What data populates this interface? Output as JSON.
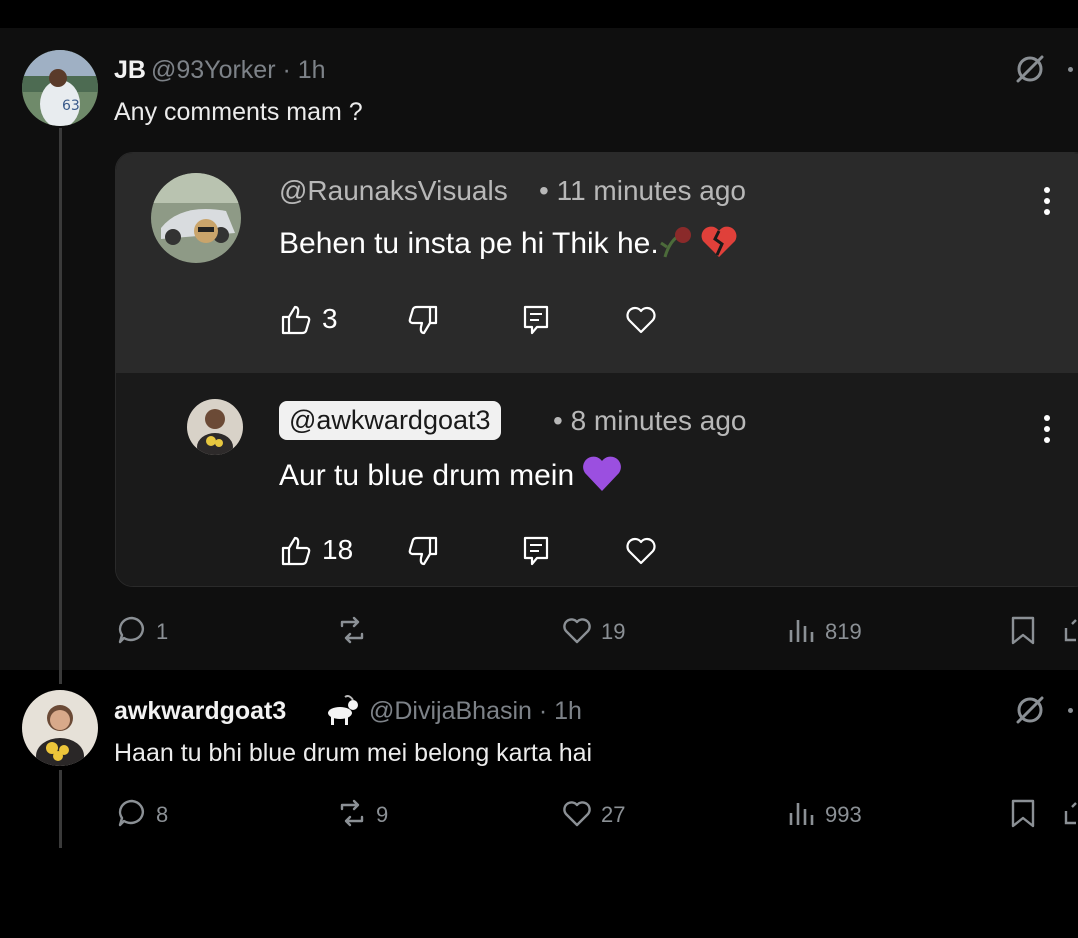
{
  "tweet1": {
    "name": "JB",
    "handle": "@93Yorker · 1h",
    "text": "Any comments mam ?",
    "actions": {
      "replies": "1",
      "retweets": "",
      "likes": "19",
      "views": "819"
    }
  },
  "youtube": {
    "comment": {
      "handle": "@RaunaksVisuals",
      "time": "• 11 minutes ago",
      "text": "Behen tu insta pe hi Thik he.",
      "likes": "3"
    },
    "reply": {
      "handle": "@awkwardgoat3",
      "time": "• 8 minutes ago",
      "text": "Aur tu blue drum mein",
      "likes": "18"
    }
  },
  "tweet2": {
    "name": "awkwardgoat3",
    "handle": "@DivijaBhasin · 1h",
    "text": "Haan tu bhi blue drum mei belong karta hai",
    "actions": {
      "replies": "8",
      "retweets": "9",
      "likes": "27",
      "views": "993"
    }
  },
  "colors": {
    "background": "#000000",
    "card_top": "#2a2a2a",
    "card_bottom": "#1a1a1a",
    "muted": "#7d8288",
    "purple_heart": "#9b4fe0",
    "broken_heart": "#e0403a"
  },
  "icons": [
    "grok-icon",
    "more-icon",
    "thumbs-up-icon",
    "thumbs-down-icon",
    "reply-icon",
    "heart-icon",
    "kebab-menu-icon",
    "retweet-icon",
    "views-icon",
    "bookmark-icon",
    "share-icon",
    "goat-emoji",
    "wilted-rose-emoji",
    "broken-heart-emoji",
    "purple-heart-emoji"
  ]
}
